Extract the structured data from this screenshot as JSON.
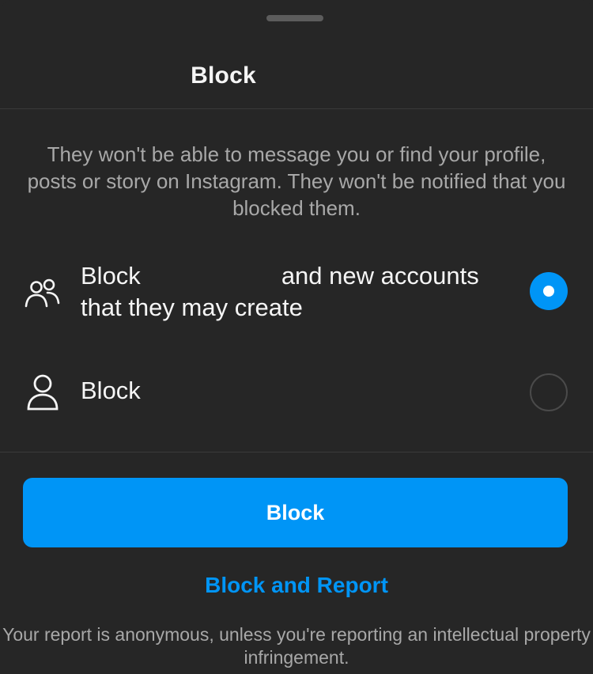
{
  "header": {
    "title": "Block"
  },
  "description": "They won't be able to message you or find your profile, posts or story on Instagram. They won't be notified that you blocked them.",
  "options": [
    {
      "icon": "users-icon",
      "label_start": "Block",
      "label_end": "and new accounts that they may create",
      "selected": true
    },
    {
      "icon": "user-icon",
      "label": "Block",
      "selected": false
    }
  ],
  "actions": {
    "primary_label": "Block",
    "secondary_label": "Block and Report"
  },
  "footnote": "Your report is anonymous, unless you're reporting an intellectual property infringement.",
  "colors": {
    "accent": "#0095f6",
    "background": "#262626",
    "text": "#f5f5f5",
    "muted": "#a8a8a8"
  }
}
